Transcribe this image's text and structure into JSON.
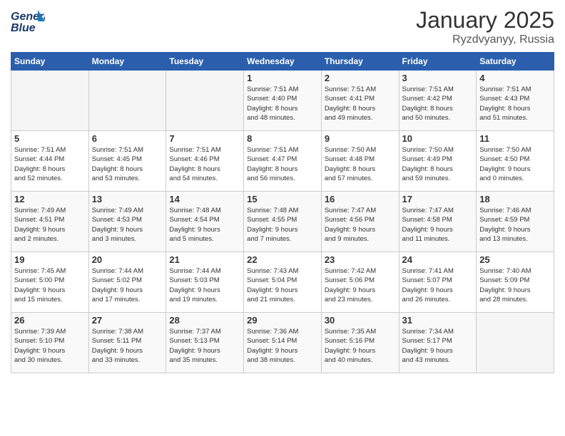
{
  "header": {
    "logo_line1": "General",
    "logo_line2": "Blue",
    "month_year": "January 2025",
    "location": "Ryzdvyanyy, Russia"
  },
  "weekdays": [
    "Sunday",
    "Monday",
    "Tuesday",
    "Wednesday",
    "Thursday",
    "Friday",
    "Saturday"
  ],
  "weeks": [
    [
      {
        "day": "",
        "info": ""
      },
      {
        "day": "",
        "info": ""
      },
      {
        "day": "",
        "info": ""
      },
      {
        "day": "1",
        "info": "Sunrise: 7:51 AM\nSunset: 4:40 PM\nDaylight: 8 hours\nand 48 minutes."
      },
      {
        "day": "2",
        "info": "Sunrise: 7:51 AM\nSunset: 4:41 PM\nDaylight: 8 hours\nand 49 minutes."
      },
      {
        "day": "3",
        "info": "Sunrise: 7:51 AM\nSunset: 4:42 PM\nDaylight: 8 hours\nand 50 minutes."
      },
      {
        "day": "4",
        "info": "Sunrise: 7:51 AM\nSunset: 4:43 PM\nDaylight: 8 hours\nand 51 minutes."
      }
    ],
    [
      {
        "day": "5",
        "info": "Sunrise: 7:51 AM\nSunset: 4:44 PM\nDaylight: 8 hours\nand 52 minutes."
      },
      {
        "day": "6",
        "info": "Sunrise: 7:51 AM\nSunset: 4:45 PM\nDaylight: 8 hours\nand 53 minutes."
      },
      {
        "day": "7",
        "info": "Sunrise: 7:51 AM\nSunset: 4:46 PM\nDaylight: 8 hours\nand 54 minutes."
      },
      {
        "day": "8",
        "info": "Sunrise: 7:51 AM\nSunset: 4:47 PM\nDaylight: 8 hours\nand 56 minutes."
      },
      {
        "day": "9",
        "info": "Sunrise: 7:50 AM\nSunset: 4:48 PM\nDaylight: 8 hours\nand 57 minutes."
      },
      {
        "day": "10",
        "info": "Sunrise: 7:50 AM\nSunset: 4:49 PM\nDaylight: 8 hours\nand 59 minutes."
      },
      {
        "day": "11",
        "info": "Sunrise: 7:50 AM\nSunset: 4:50 PM\nDaylight: 9 hours\nand 0 minutes."
      }
    ],
    [
      {
        "day": "12",
        "info": "Sunrise: 7:49 AM\nSunset: 4:51 PM\nDaylight: 9 hours\nand 2 minutes."
      },
      {
        "day": "13",
        "info": "Sunrise: 7:49 AM\nSunset: 4:53 PM\nDaylight: 9 hours\nand 3 minutes."
      },
      {
        "day": "14",
        "info": "Sunrise: 7:48 AM\nSunset: 4:54 PM\nDaylight: 9 hours\nand 5 minutes."
      },
      {
        "day": "15",
        "info": "Sunrise: 7:48 AM\nSunset: 4:55 PM\nDaylight: 9 hours\nand 7 minutes."
      },
      {
        "day": "16",
        "info": "Sunrise: 7:47 AM\nSunset: 4:56 PM\nDaylight: 9 hours\nand 9 minutes."
      },
      {
        "day": "17",
        "info": "Sunrise: 7:47 AM\nSunset: 4:58 PM\nDaylight: 9 hours\nand 11 minutes."
      },
      {
        "day": "18",
        "info": "Sunrise: 7:46 AM\nSunset: 4:59 PM\nDaylight: 9 hours\nand 13 minutes."
      }
    ],
    [
      {
        "day": "19",
        "info": "Sunrise: 7:45 AM\nSunset: 5:00 PM\nDaylight: 9 hours\nand 15 minutes."
      },
      {
        "day": "20",
        "info": "Sunrise: 7:44 AM\nSunset: 5:02 PM\nDaylight: 9 hours\nand 17 minutes."
      },
      {
        "day": "21",
        "info": "Sunrise: 7:44 AM\nSunset: 5:03 PM\nDaylight: 9 hours\nand 19 minutes."
      },
      {
        "day": "22",
        "info": "Sunrise: 7:43 AM\nSunset: 5:04 PM\nDaylight: 9 hours\nand 21 minutes."
      },
      {
        "day": "23",
        "info": "Sunrise: 7:42 AM\nSunset: 5:06 PM\nDaylight: 9 hours\nand 23 minutes."
      },
      {
        "day": "24",
        "info": "Sunrise: 7:41 AM\nSunset: 5:07 PM\nDaylight: 9 hours\nand 26 minutes."
      },
      {
        "day": "25",
        "info": "Sunrise: 7:40 AM\nSunset: 5:09 PM\nDaylight: 9 hours\nand 28 minutes."
      }
    ],
    [
      {
        "day": "26",
        "info": "Sunrise: 7:39 AM\nSunset: 5:10 PM\nDaylight: 9 hours\nand 30 minutes."
      },
      {
        "day": "27",
        "info": "Sunrise: 7:38 AM\nSunset: 5:11 PM\nDaylight: 9 hours\nand 33 minutes."
      },
      {
        "day": "28",
        "info": "Sunrise: 7:37 AM\nSunset: 5:13 PM\nDaylight: 9 hours\nand 35 minutes."
      },
      {
        "day": "29",
        "info": "Sunrise: 7:36 AM\nSunset: 5:14 PM\nDaylight: 9 hours\nand 38 minutes."
      },
      {
        "day": "30",
        "info": "Sunrise: 7:35 AM\nSunset: 5:16 PM\nDaylight: 9 hours\nand 40 minutes."
      },
      {
        "day": "31",
        "info": "Sunrise: 7:34 AM\nSunset: 5:17 PM\nDaylight: 9 hours\nand 43 minutes."
      },
      {
        "day": "",
        "info": ""
      }
    ]
  ]
}
